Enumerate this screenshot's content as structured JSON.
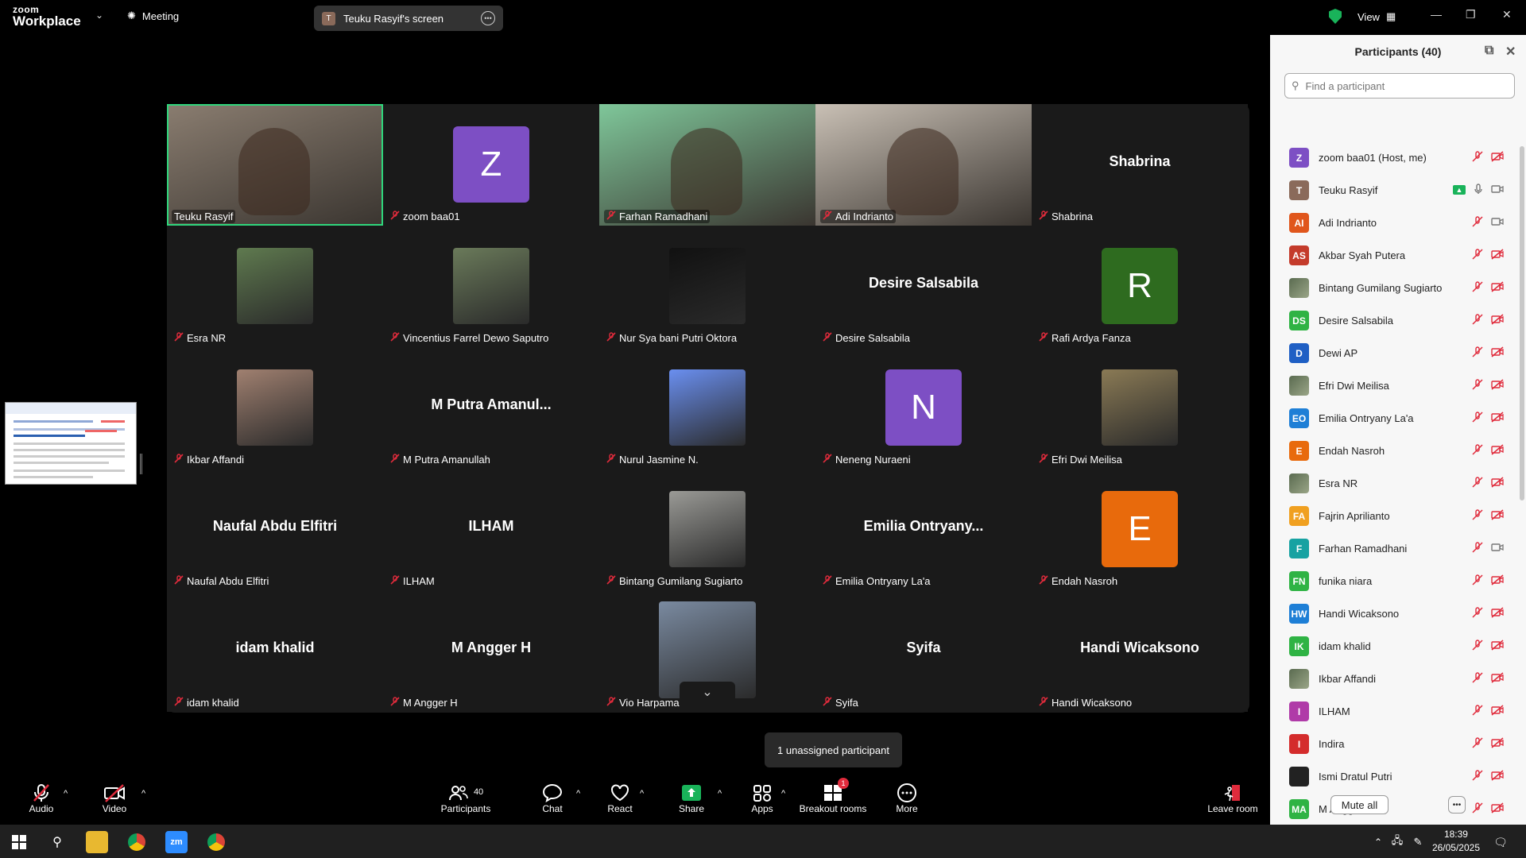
{
  "app": {
    "logo_line1": "zoom",
    "logo_line2": "Workplace",
    "meeting_label": "Meeting",
    "screen_label": "Teuku Rasyif's screen",
    "screen_avatar": "T",
    "view_label": "View"
  },
  "tiles": [
    {
      "name": "Teuku Rasyif",
      "type": "photo",
      "color": "#8a7d70",
      "active": true
    },
    {
      "name": "zoom baa01",
      "type": "avatar",
      "letter": "Z",
      "color": "#7d4fc4"
    },
    {
      "name": "Farhan Ramadhani",
      "type": "photo",
      "color": "#7fc79a"
    },
    {
      "name": "Adi Indrianto",
      "type": "photo",
      "color": "#c9c0b5"
    },
    {
      "name": "Shabrina",
      "type": "text",
      "big": "Shabrina"
    },
    {
      "name": "Esra NR",
      "type": "thumb",
      "color": "#5f7a4f"
    },
    {
      "name": "Vincentius Farrel Dewo Saputro",
      "type": "thumb",
      "color": "#6a7a5a"
    },
    {
      "name": "Nur Sya bani Putri Oktora",
      "type": "thumb",
      "color": "#111111"
    },
    {
      "name": "Desire Salsabila",
      "type": "text",
      "big": "Desire Salsabila"
    },
    {
      "name": "Rafi Ardya Fanza",
      "type": "avatar",
      "letter": "R",
      "color": "#2e6b1f"
    },
    {
      "name": "Ikbar Affandi",
      "type": "thumb",
      "color": "#a08070"
    },
    {
      "name": "M Putra Amanullah",
      "type": "text",
      "big": "M  Putra  Amanul..."
    },
    {
      "name": "Nurul Jasmine N.",
      "type": "thumb",
      "color": "#6a8ff0"
    },
    {
      "name": "Neneng Nuraeni",
      "type": "avatar",
      "letter": "N",
      "color": "#7d4fc4"
    },
    {
      "name": "Efri Dwi Meilisa",
      "type": "thumb",
      "color": "#8a7a55"
    },
    {
      "name": "Naufal Abdu Elfitri",
      "type": "text",
      "big": "Naufal Abdu Elfitri"
    },
    {
      "name": "ILHAM",
      "type": "text",
      "big": "ILHAM"
    },
    {
      "name": "Bintang Gumilang Sugiarto",
      "type": "thumb",
      "color": "#9a9a96"
    },
    {
      "name": "Emilia Ontryany La'a",
      "type": "text",
      "big": "Emilia  Ontryany..."
    },
    {
      "name": "Endah Nasroh",
      "type": "avatar",
      "letter": "E",
      "color": "#e86a0c"
    },
    {
      "name": "idam khalid",
      "type": "text",
      "big": "idam khalid"
    },
    {
      "name": "M Angger H",
      "type": "text",
      "big": "M Angger H"
    },
    {
      "name": "Vio Harpama",
      "type": "thumbwide",
      "color": "#7a8aa0"
    },
    {
      "name": "Syifa",
      "type": "text",
      "big": "Syifa"
    },
    {
      "name": "Handi Wicaksono",
      "type": "text",
      "big": "Handi Wicaksono"
    }
  ],
  "tooltip": "1 unassigned participant",
  "toolbar": {
    "audio": "Audio",
    "video": "Video",
    "participants": "Participants",
    "participants_count": "40",
    "chat": "Chat",
    "react": "React",
    "share": "Share",
    "apps": "Apps",
    "breakout": "Breakout rooms",
    "breakout_badge": "1",
    "more": "More",
    "leave": "Leave room"
  },
  "panel": {
    "title": "Participants (40)",
    "search_placeholder": "Find a participant",
    "mute_all": "Mute all",
    "participants": [
      {
        "initials": "Z",
        "name": "zoom baa01 (Host, me)",
        "color": "#7d4fc4",
        "video": "off"
      },
      {
        "initials": "T",
        "name": "Teuku Rasyif",
        "color": "#8a6a5a",
        "video": "on",
        "sharing": true
      },
      {
        "initials": "AI",
        "name": "Adi Indrianto",
        "color": "#e0561c",
        "video": "on"
      },
      {
        "initials": "AS",
        "name": "Akbar Syah Putera",
        "color": "#c43b2b",
        "video": "off"
      },
      {
        "initials": "",
        "name": "Bintang Gumilang Sugiarto",
        "color": "",
        "img": true,
        "video": "off"
      },
      {
        "initials": "DS",
        "name": "Desire Salsabila",
        "color": "#2fb344",
        "video": "off"
      },
      {
        "initials": "D",
        "name": "Dewi AP",
        "color": "#1f5fc4",
        "video": "off"
      },
      {
        "initials": "",
        "name": "Efri Dwi Meilisa",
        "color": "",
        "img": true,
        "video": "off"
      },
      {
        "initials": "EO",
        "name": "Emilia Ontryany La'a",
        "color": "#1e7fd6",
        "video": "off"
      },
      {
        "initials": "E",
        "name": "Endah Nasroh",
        "color": "#e86a0c",
        "video": "off"
      },
      {
        "initials": "",
        "name": "Esra NR",
        "color": "",
        "img": true,
        "video": "off"
      },
      {
        "initials": "FA",
        "name": "Fajrin Aprilianto",
        "color": "#f0a020",
        "video": "off"
      },
      {
        "initials": "F",
        "name": "Farhan Ramadhani",
        "color": "#17a2a2",
        "video": "on"
      },
      {
        "initials": "FN",
        "name": "funika niara",
        "color": "#2fb344",
        "video": "off"
      },
      {
        "initials": "HW",
        "name": "Handi Wicaksono",
        "color": "#1e7fd6",
        "video": "off"
      },
      {
        "initials": "IK",
        "name": "idam khalid",
        "color": "#2fb344",
        "video": "off"
      },
      {
        "initials": "",
        "name": "Ikbar Affandi",
        "color": "",
        "img": true,
        "video": "off"
      },
      {
        "initials": "I",
        "name": "ILHAM",
        "color": "#b03aa8",
        "video": "off"
      },
      {
        "initials": "I",
        "name": "Indira",
        "color": "#d42c2c",
        "video": "off"
      },
      {
        "initials": "",
        "name": "Ismi Dratul Putri",
        "color": "#222222",
        "video": "off"
      },
      {
        "initials": "MA",
        "name": "M Angger H",
        "color": "#2fb344",
        "video": "off"
      }
    ]
  },
  "taskbar": {
    "time": "18:39",
    "date": "26/05/2025"
  }
}
